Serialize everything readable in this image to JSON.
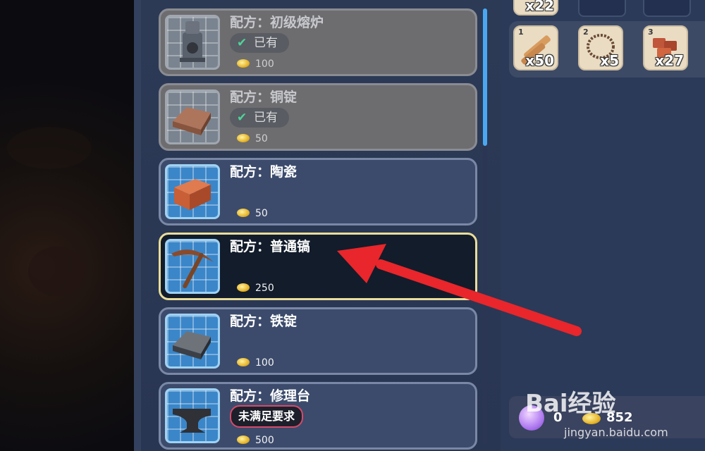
{
  "recipes": [
    {
      "title": "配方：初级熔炉",
      "owned": true,
      "owned_label": "已有",
      "price": "100",
      "icon": "furnace-icon"
    },
    {
      "title": "配方：铜锭",
      "owned": true,
      "owned_label": "已有",
      "price": "50",
      "icon": "copper-ingot-icon"
    },
    {
      "title": "配方：陶瓷",
      "owned": false,
      "price": "50",
      "icon": "ceramic-brick-icon"
    },
    {
      "title": "配方：普通镐",
      "owned": false,
      "selected": true,
      "price": "250",
      "icon": "pickaxe-icon"
    },
    {
      "title": "配方：铁锭",
      "owned": false,
      "price": "100",
      "icon": "iron-ingot-icon"
    },
    {
      "title": "配方：修理台",
      "owned": false,
      "requirement": "未满足要求",
      "price": "500",
      "icon": "anvil-icon"
    }
  ],
  "inventory": {
    "top_partial_count": "x22",
    "slots": [
      {
        "num": "1",
        "count": "x50",
        "icon": "wood-plank-icon"
      },
      {
        "num": "2",
        "count": "x5",
        "icon": "vine-coil-icon"
      },
      {
        "num": "3",
        "count": "x27",
        "icon": "brick-pile-icon"
      }
    ]
  },
  "currency": {
    "gems": "0",
    "coins": "852"
  },
  "watermark": {
    "brand": "Bai经验",
    "url": "jingyan.baidu.com"
  },
  "colors": {
    "accent_blue": "#4aa8f2",
    "selected_border": "#e9dd9a",
    "requirement_border": "#d54a69",
    "arrow": "#e8262b"
  }
}
